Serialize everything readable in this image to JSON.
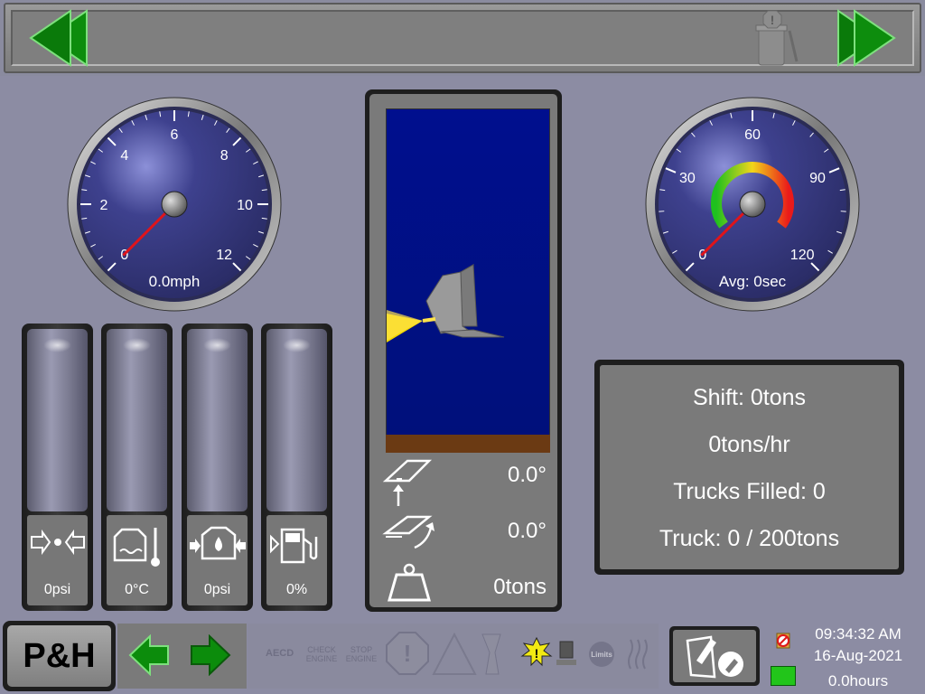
{
  "top_bar": {
    "prev_button_icon": "double-left-arrow-icon",
    "next_button_icon": "double-right-arrow-icon",
    "clear_icon": "trash-alert-icon"
  },
  "speed_gauge": {
    "ticks": [
      "0",
      "2",
      "4",
      "6",
      "8",
      "10",
      "12"
    ],
    "readout": "0.0mph",
    "value": 0
  },
  "cycle_gauge": {
    "ticks": [
      "0",
      "30",
      "60",
      "90",
      "120"
    ],
    "readout": "Avg: 0sec",
    "value": 0
  },
  "tanks": [
    {
      "icon": "hydraulic-pressure-icon",
      "label": "0psi"
    },
    {
      "icon": "coolant-temp-icon",
      "label": "0°C"
    },
    {
      "icon": "oil-pressure-icon",
      "label": "0psi"
    },
    {
      "icon": "fuel-icon",
      "label": "0%"
    }
  ],
  "dipper": {
    "tilt_angle": "0.0°",
    "pitch_angle": "0.0°",
    "payload": "0tons"
  },
  "stats": {
    "shift": "Shift: 0tons",
    "rate": "0tons/hr",
    "trucks_filled": "Trucks Filled: 0",
    "truck": "Truck: 0 / 200tons"
  },
  "bottom_bar": {
    "logo": "P&H",
    "alarm_aecd": "AECD",
    "alarm_check_engine": "CHECK ENGINE",
    "alarm_stop_engine": "STOP ENGINE",
    "alarm_limits": "Limits"
  },
  "status": {
    "time": "09:34:32 AM",
    "date": "16-Aug-2021",
    "hours": "0.0hours",
    "indicator_color": "#22c51a"
  },
  "colors": {
    "nav_arrow": "#0a8a0a",
    "sky": "#000f8e",
    "ground": "#6b3a13"
  }
}
